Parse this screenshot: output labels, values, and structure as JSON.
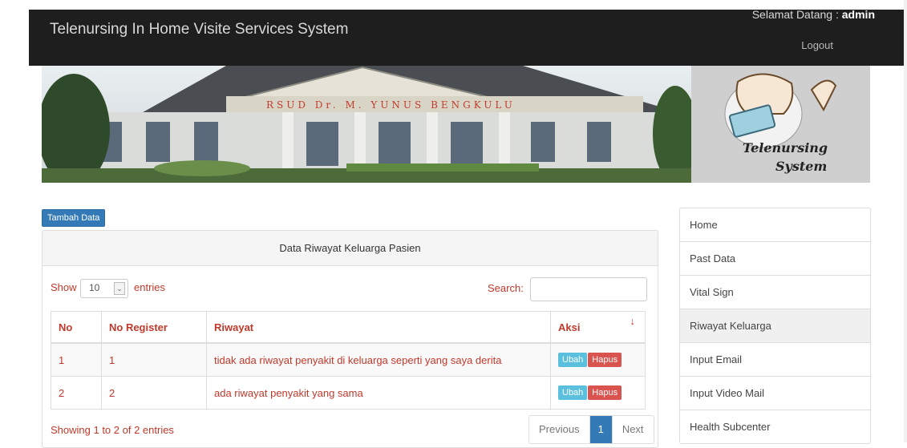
{
  "header": {
    "brand": "Telenursing In Home Visite Services System",
    "welcome_prefix": "Selamat Datang :",
    "username": "admin",
    "logout": "Logout"
  },
  "banner": {
    "building_sign": "RSUD Dr. M. YUNUS BENGKULU",
    "logo_line1": "Telenursing",
    "logo_line2": "System"
  },
  "toolbar": {
    "add_label": "Tambah Data"
  },
  "panel": {
    "title": "Data Riwayat Keluarga Pasien",
    "show_label": "Show",
    "entries_value": "10",
    "entries_label": "entries",
    "search_label": "Search:",
    "search_value": "",
    "columns": [
      "No",
      "No Register",
      "Riwayat",
      "Aksi"
    ],
    "rows": [
      {
        "no": "1",
        "reg": "1",
        "riwayat": "tidak ada riwayat penyakit di keluarga seperti yang saya derita",
        "edit": "Ubah",
        "delete": "Hapus"
      },
      {
        "no": "2",
        "reg": "2",
        "riwayat": "ada riwayat penyakit yang sama",
        "edit": "Ubah",
        "delete": "Hapus"
      }
    ],
    "info": "Showing 1 to 2 of 2 entries",
    "pager": {
      "prev": "Previous",
      "page": "1",
      "next": "Next"
    }
  },
  "menu": {
    "items": [
      "Home",
      "Past Data",
      "Vital Sign",
      "Riwayat Keluarga",
      "Input Email",
      "Input Video Mail",
      "Health Subcenter"
    ],
    "active": "Riwayat Keluarga"
  },
  "colors": {
    "accent": "#337ab7",
    "danger": "#d9534f",
    "info": "#5bc0de",
    "text_red": "#c0392b",
    "nav": "#1e1e1e"
  }
}
